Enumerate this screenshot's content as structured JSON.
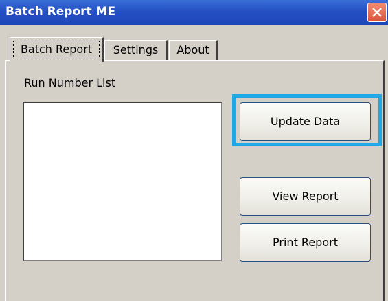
{
  "window": {
    "title": "Batch Report ME",
    "close_icon": "close-icon"
  },
  "tabs": [
    {
      "label": "Batch Report",
      "active": true
    },
    {
      "label": "Settings",
      "active": false
    },
    {
      "label": "About",
      "active": false
    }
  ],
  "panel": {
    "list_label": "Run Number List",
    "run_numbers": [],
    "buttons": {
      "update": "Update Data",
      "view": "View Report",
      "print": "Print Report"
    },
    "highlight_color": "#1ea8e6"
  }
}
